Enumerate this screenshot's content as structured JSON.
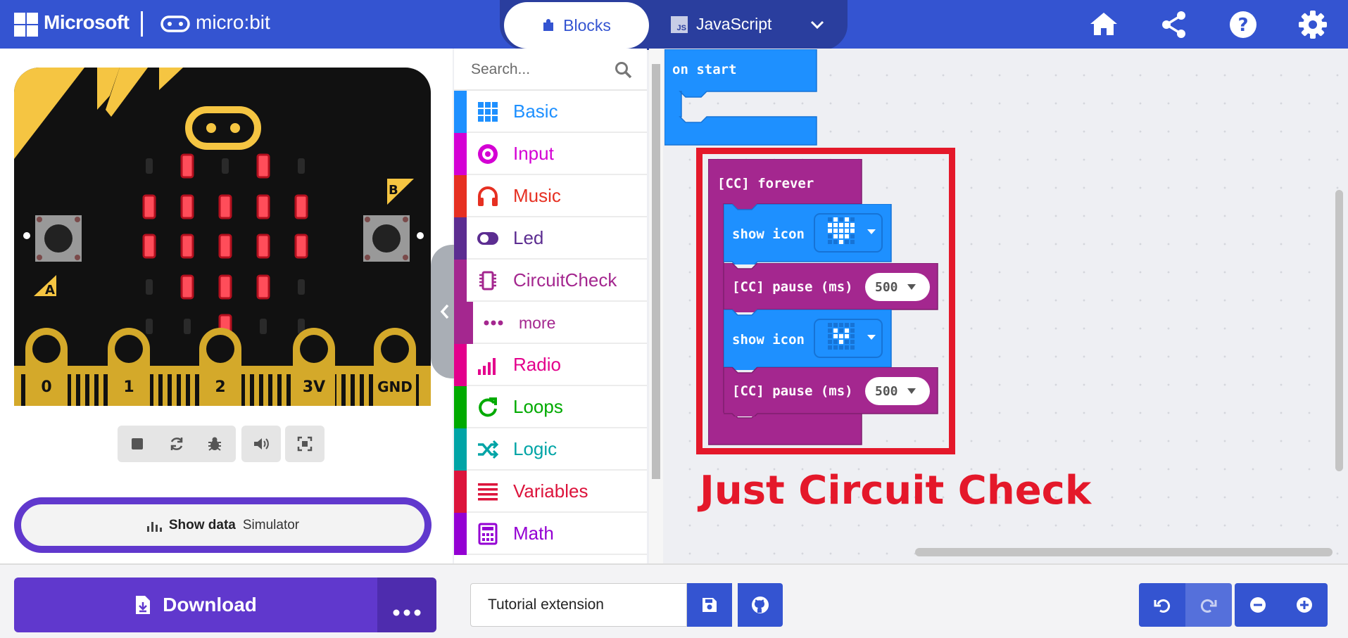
{
  "header": {
    "brand": "Microsoft",
    "product": "micro:bit",
    "tabs": [
      {
        "label": "Blocks",
        "icon": "puzzle-icon",
        "active": true
      },
      {
        "label": "JavaScript",
        "icon": "js-icon",
        "badge": "JS",
        "active": false
      }
    ],
    "right_icons": [
      "home-icon",
      "share-icon",
      "help-icon",
      "settings-icon"
    ]
  },
  "simulator": {
    "pins": [
      "0",
      "1",
      "2",
      "3V",
      "GND"
    ],
    "button_labels": [
      "A",
      "B"
    ],
    "led_matrix": [
      [
        0,
        1,
        0,
        1,
        0
      ],
      [
        1,
        1,
        1,
        1,
        1
      ],
      [
        1,
        1,
        1,
        1,
        1
      ],
      [
        0,
        1,
        1,
        1,
        0
      ],
      [
        0,
        0,
        1,
        0,
        0
      ]
    ],
    "controls": [
      "stop-icon",
      "restart-icon",
      "debug-icon",
      "sound-icon",
      "fullscreen-icon"
    ],
    "show_data": {
      "bold": "Show data",
      "label": "Simulator"
    }
  },
  "toolbox": {
    "search_placeholder": "Search...",
    "categories": [
      {
        "label": "Basic",
        "color": "#1e90ff",
        "icon": "grid-icon"
      },
      {
        "label": "Input",
        "color": "#d400d4",
        "icon": "target-icon"
      },
      {
        "label": "Music",
        "color": "#e63022",
        "icon": "headphones-icon"
      },
      {
        "label": "Led",
        "color": "#5c2d91",
        "icon": "toggle-icon"
      },
      {
        "label": "CircuitCheck",
        "color": "#a4278f",
        "icon": "chip-icon"
      },
      {
        "label": "more",
        "color": "#a4278f",
        "icon": "ellipsis-icon"
      },
      {
        "label": "Radio",
        "color": "#e3008c",
        "icon": "signal-icon"
      },
      {
        "label": "Loops",
        "color": "#00aa00",
        "icon": "loop-icon"
      },
      {
        "label": "Logic",
        "color": "#00a4a6",
        "icon": "shuffle-icon"
      },
      {
        "label": "Variables",
        "color": "#dc143c",
        "icon": "lines-icon"
      },
      {
        "label": "Math",
        "color": "#9400d3",
        "icon": "calculator-icon"
      }
    ]
  },
  "workspace": {
    "on_start": "on start",
    "forever": "[CC] forever",
    "show_icon_1": "show icon",
    "pause_1": "[CC] pause (ms)",
    "pause_1_value": "500",
    "show_icon_2": "show icon",
    "pause_2": "[CC] pause (ms)",
    "pause_2_value": "500",
    "annotation": "Just Circuit Check",
    "colors": {
      "basic": "#1e90ff",
      "circuitcheck": "#a4278f",
      "annotation": "#e4182a"
    }
  },
  "bottom": {
    "download": "Download",
    "project_name": "Tutorial extension",
    "buttons": [
      "save-icon",
      "github-icon",
      "undo-icon",
      "redo-icon",
      "zoom-out-icon",
      "zoom-in-icon"
    ]
  },
  "colors": {
    "topbar": "#3454d1",
    "download": "#6038cd"
  }
}
